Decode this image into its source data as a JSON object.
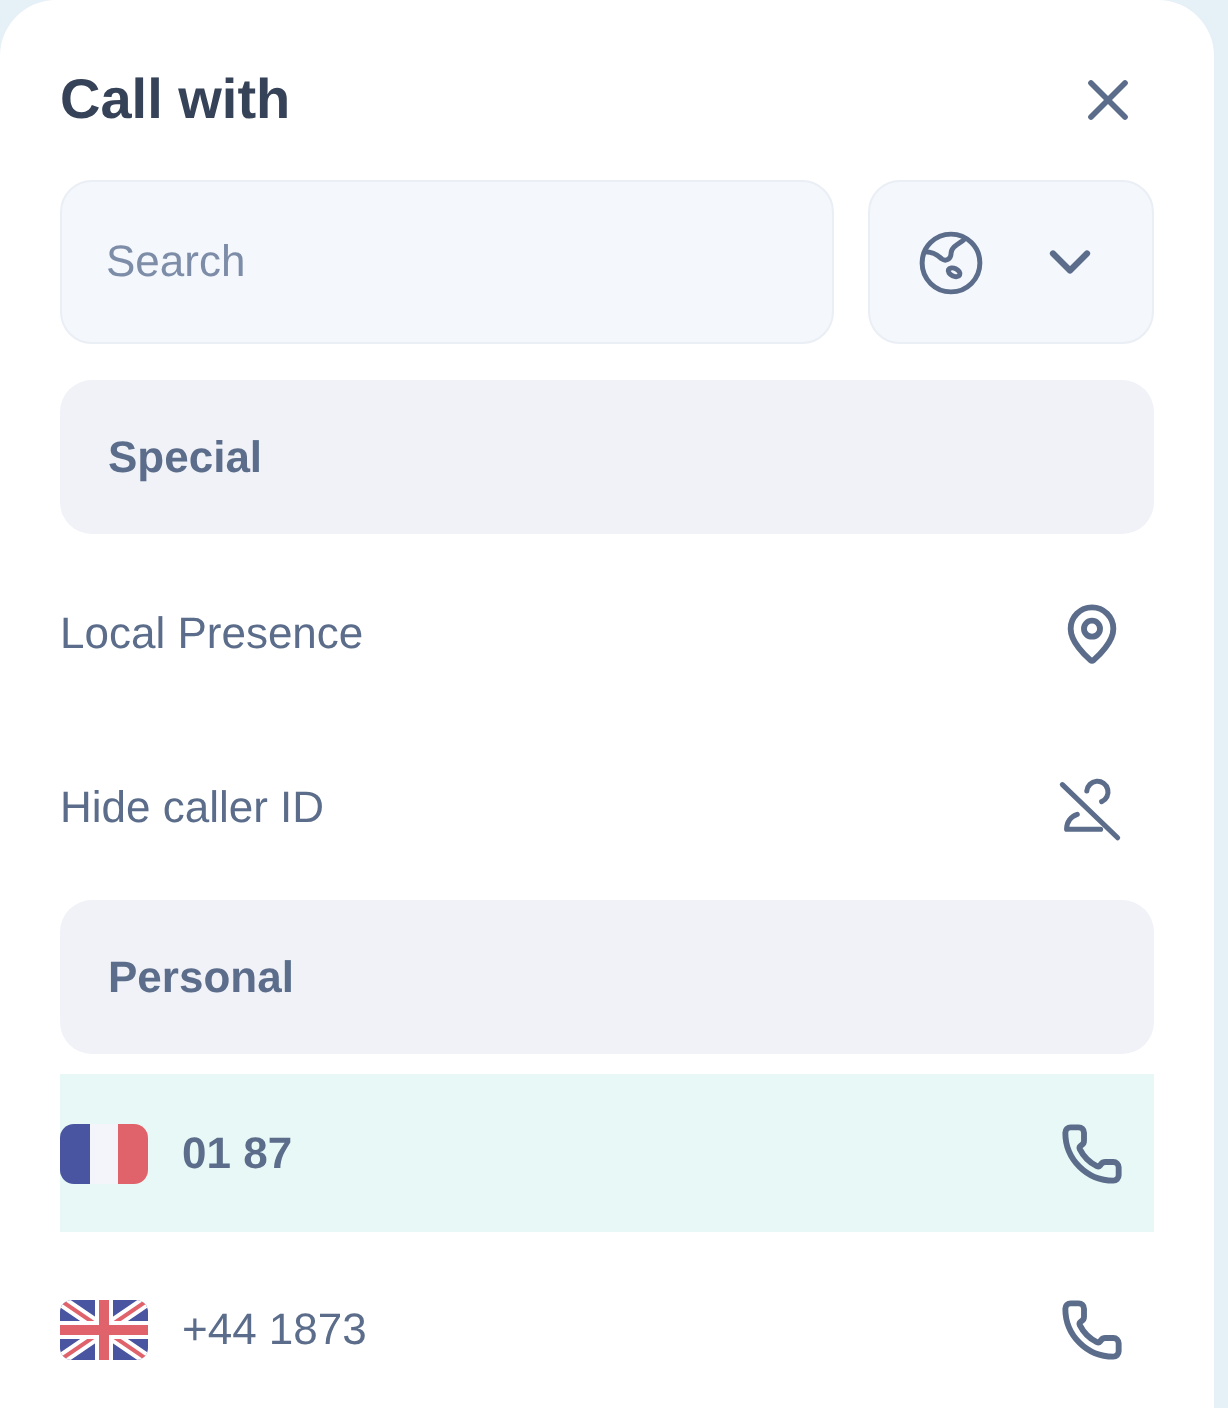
{
  "dialog": {
    "title": "Call with"
  },
  "search": {
    "placeholder": "Search"
  },
  "special": {
    "title": "Special",
    "options": [
      {
        "kind": "presence",
        "label": "Local Presence"
      },
      {
        "kind": "hidden",
        "label": "Hide caller ID"
      }
    ]
  },
  "personal": {
    "title": "Personal",
    "numbers": [
      {
        "kind": "france",
        "number": "01 87",
        "selected": true
      },
      {
        "kind": "uk",
        "number": "+44 1873",
        "selected": false
      }
    ]
  }
}
